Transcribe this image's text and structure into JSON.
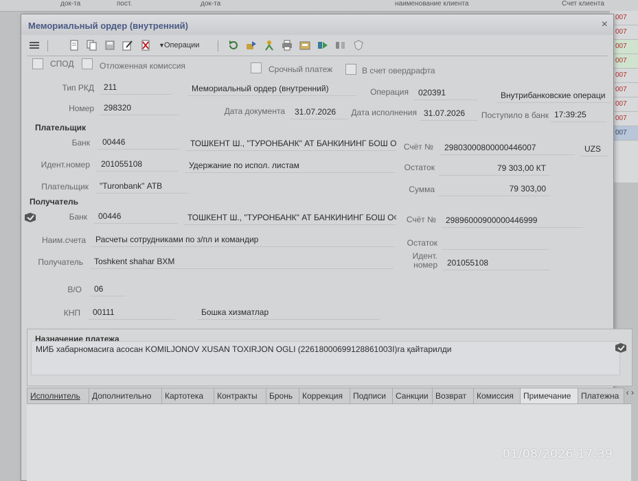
{
  "background": {
    "headers": [
      "док-та",
      "пост.",
      "док-та",
      "наименование клиента",
      "Счет клиента"
    ],
    "right_cells": [
      "007",
      "007",
      "007",
      "007",
      "007",
      "007",
      "007",
      "007",
      "007"
    ]
  },
  "window": {
    "title": "Мемориальный ордер (внутренний)",
    "close": "×"
  },
  "toolbar": {
    "operations_label": "Операции"
  },
  "flags": {
    "spod": "СПОД",
    "deferred_commission": "Отложенная комиссия",
    "urgent_payment": "Срочный платеж",
    "overdraft": "В счет овердрафта"
  },
  "doc": {
    "rkd_type_label": "Тип РКД",
    "rkd_type": "211",
    "rkd_name": "Мемориальный ордер (внутренний)",
    "operation_label": "Операция",
    "operation_code": "020391",
    "operation_name": "Внутрибанковские операци",
    "number_label": "Номер",
    "number": "298320",
    "doc_date_label": "Дата документа",
    "doc_date": "31.07.2026",
    "exec_date_label": "Дата исполнения",
    "exec_date": "31.07.2026",
    "received_label": "Поступило в банк",
    "received_time": "17:39:25"
  },
  "payer": {
    "section": "Плательщик",
    "bank_label": "Банк",
    "bank_code": "00446",
    "bank_name": "ТОШКЕНТ Ш., \"ТУРОНБАНК\" АТ БАНКИНИНГ БОШ ОФ",
    "account_label": "Счёт №",
    "account": "29803000800000446007",
    "currency": "UZS",
    "id_label": "Идент.номер",
    "id_number": "201055108",
    "purpose_note": "Удержание по испол. листам",
    "balance_label": "Остаток",
    "balance": "79 303,00 КТ",
    "name_label": "Плательщик",
    "name": "\"Turonbank\" АТВ",
    "amount_label": "Сумма",
    "amount": "79 303,00"
  },
  "receiver": {
    "section": "Получатель",
    "bank_label": "Банк",
    "bank_code": "00446",
    "bank_name": "ТОШКЕНТ Ш., \"ТУРОНБАНК\" АТ БАНКИНИНГ БОШ ОФ",
    "account_label": "Счёт №",
    "account": "29896000900000446999",
    "acc_name_label": "Наим.счета",
    "acc_name": "Расчеты сотрудниками по з/пл и командир",
    "balance_label": "Остаток",
    "name_label": "Получатель",
    "name": "Toshkent shahar BXM",
    "id_label_1": "Идент.",
    "id_label_2": "номер",
    "id_number": "201055108"
  },
  "misc": {
    "vo_label": "В/О",
    "vo": "06",
    "knp_label": "КНП",
    "knp": "00111",
    "knp_name": "Бошка хизматлар"
  },
  "purpose": {
    "label": "Назначение платежа",
    "text": "МИБ хабарномасига асосан KOMILJONOV XUSAN TOXIRJON OGLI (22618000699128861003I)га қайтарилди"
  },
  "tabs": [
    "Исполнитель",
    "Дополнительно",
    "Картотека",
    "Контракты",
    "Бронь",
    "Коррекция",
    "Подписи",
    "Санкции",
    "Возврат",
    "Комиссия",
    "Примечание",
    "Платежна"
  ],
  "tab_arrows": "‹ ›",
  "photo_stamp": "01/08/2026 17:39",
  "colors": {
    "title": "#4a5a84",
    "dialog_bg": "#d4d5d7",
    "grid_red": "#b0302a"
  }
}
